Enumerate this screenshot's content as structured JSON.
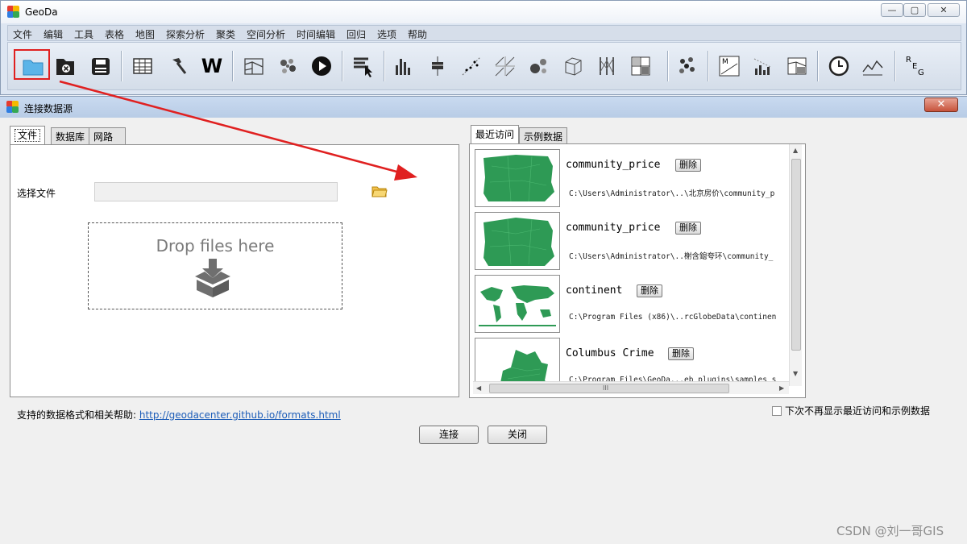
{
  "app": {
    "title": "GeoDa"
  },
  "window_controls": {
    "minimize": "—",
    "maximize": "▢",
    "close": "✕"
  },
  "menu": [
    "文件",
    "编辑",
    "工具",
    "表格",
    "地图",
    "探索分析",
    "聚类",
    "空间分析",
    "时间编辑",
    "回归",
    "选项",
    "帮助"
  ],
  "toolbar": {
    "icons": [
      "folder-open-icon",
      "close-file-icon",
      "save-icon",
      "table-icon",
      "hammer-icon",
      "weights-icon",
      "map-icon",
      "cartogram-icon",
      "play-icon",
      "select-icon",
      "histogram-icon",
      "boxplot-icon",
      "scatter-icon",
      "scatter-matrix-icon",
      "bubble-icon",
      "cube-icon",
      "parallel-coords-icon",
      "conditional-map-icon",
      "cluster-icon",
      "moran-icon",
      "lisa-icon",
      "local-g-icon",
      "clock-icon",
      "line-chart-icon",
      "regression-icon"
    ],
    "weights_glyph": "W",
    "reg_glyph_r": "R",
    "reg_glyph_e": "E",
    "reg_glyph_g": "G"
  },
  "dialog": {
    "title": "连接数据源",
    "close": "✕",
    "left_tabs": [
      "文件",
      "数据库",
      "网路"
    ],
    "file_label": "选择文件",
    "drop_text": "Drop files here",
    "help_prefix": "支持的数据格式和相关帮助: ",
    "help_link": "http://geodacenter.github.io/formats.html",
    "right_tabs": [
      "最近访问",
      "示例数据"
    ],
    "recent": [
      {
        "name": "community_price",
        "delete": "删除",
        "path": "C:\\Users\\Administrator\\..\\北京房价\\community_p"
      },
      {
        "name": "community_price",
        "delete": "删除",
        "path": "C:\\Users\\Administrator\\..榭含鎴夸环\\community_"
      },
      {
        "name": "continent",
        "delete": "删除",
        "path": "C:\\Program Files (x86)\\..rcGlobeData\\continen"
      },
      {
        "name": "Columbus Crime",
        "delete": "删除",
        "path": "C:\\Program Files\\GeoDa...eb plugins\\samples s"
      }
    ],
    "dont_show": "下次不再显示最近访问和示例数据",
    "connect": "连接",
    "close_btn": "关闭",
    "scroll_up": "▲",
    "scroll_down": "▼",
    "scroll_left": "◀",
    "scroll_right": "▶",
    "grip": "III"
  },
  "watermark": "CSDN @刘一哥GIS",
  "colors": {
    "highlight": "#e02020",
    "map_fill": "#2e9a55",
    "link": "#1d5db8"
  }
}
